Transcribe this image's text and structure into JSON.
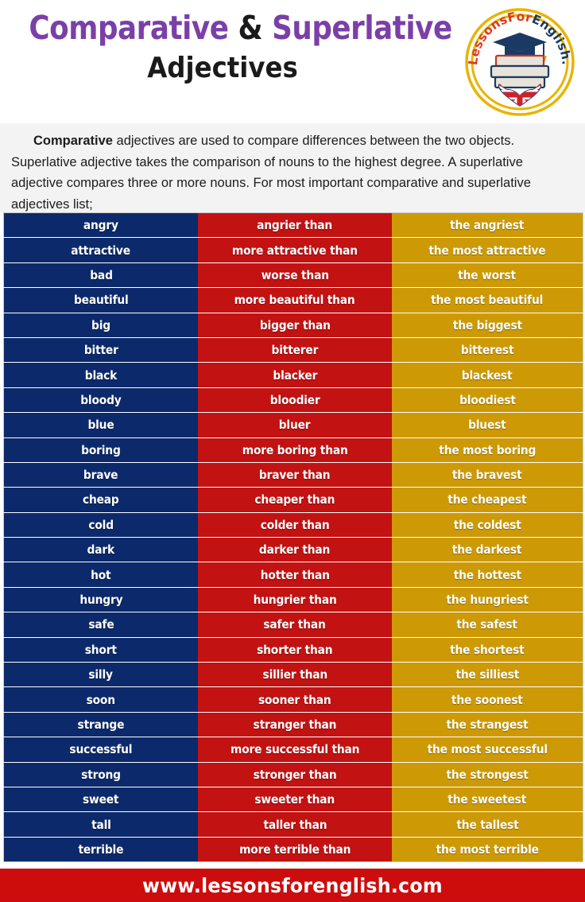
{
  "header": {
    "title_part1": "Comparative",
    "title_amp": " & ",
    "title_part2": "Superlative",
    "title_line2": "Adjectives",
    "logo": {
      "brand_text": "LessonsForEnglish.Com",
      "colors": {
        "ring": "#E8B400",
        "lessons_for": "#E03A1E",
        "english": "#1B3A63",
        "dot_com": "#1B3A63"
      }
    }
  },
  "intro": {
    "lead_word": "Comparative",
    "body": " adjectives are used to compare differences between the two objects. Superlative adjective takes the comparison of nouns to the highest degree. A superlative adjective compares three or more nouns. For most important  comparative and superlative adjectives list;"
  },
  "table": {
    "colors": {
      "base_column": "#0C2A6B",
      "comparative_column": "#C21212",
      "superlative_column": "#CD9A06"
    },
    "rows": [
      {
        "base": "angry",
        "comparative": "angrier than",
        "superlative": "the angriest"
      },
      {
        "base": "attractive",
        "comparative": "more attractive than",
        "superlative": "the most attractive"
      },
      {
        "base": "bad",
        "comparative": "worse than",
        "superlative": "the worst"
      },
      {
        "base": "beautiful",
        "comparative": "more beautiful than",
        "superlative": "the most beautiful"
      },
      {
        "base": "big",
        "comparative": "bigger than",
        "superlative": "the biggest"
      },
      {
        "base": "bitter",
        "comparative": "bitterer",
        "superlative": "bitterest"
      },
      {
        "base": "black",
        "comparative": "blacker",
        "superlative": "blackest"
      },
      {
        "base": "bloody",
        "comparative": "bloodier",
        "superlative": "bloodiest"
      },
      {
        "base": "blue",
        "comparative": "bluer",
        "superlative": "bluest"
      },
      {
        "base": "boring",
        "comparative": "more boring than",
        "superlative": "the most boring"
      },
      {
        "base": "brave",
        "comparative": "braver than",
        "superlative": "the bravest"
      },
      {
        "base": "cheap",
        "comparative": "cheaper than",
        "superlative": "the cheapest"
      },
      {
        "base": "cold",
        "comparative": "colder than",
        "superlative": "the coldest"
      },
      {
        "base": "dark",
        "comparative": "darker than",
        "superlative": "the darkest"
      },
      {
        "base": "hot",
        "comparative": "hotter than",
        "superlative": "the hottest"
      },
      {
        "base": "hungry",
        "comparative": "hungrier than",
        "superlative": "the hungriest"
      },
      {
        "base": "safe",
        "comparative": "safer than",
        "superlative": "the safest"
      },
      {
        "base": "short",
        "comparative": "shorter than",
        "superlative": "the shortest"
      },
      {
        "base": "silly",
        "comparative": "sillier than",
        "superlative": "the silliest"
      },
      {
        "base": "soon",
        "comparative": "sooner than",
        "superlative": "the soonest"
      },
      {
        "base": "strange",
        "comparative": "stranger than",
        "superlative": "the strangest"
      },
      {
        "base": "successful",
        "comparative": "more successful than",
        "superlative": "the most successful"
      },
      {
        "base": "strong",
        "comparative": "stronger than",
        "superlative": "the strongest"
      },
      {
        "base": "sweet",
        "comparative": "sweeter than",
        "superlative": "the sweetest"
      },
      {
        "base": "tall",
        "comparative": "taller than",
        "superlative": "the tallest"
      },
      {
        "base": "terrible",
        "comparative": "more terrible than",
        "superlative": "the most terrible"
      }
    ]
  },
  "footer": {
    "url": "www.lessonsforenglish.com",
    "background": "#CD0D0D"
  }
}
